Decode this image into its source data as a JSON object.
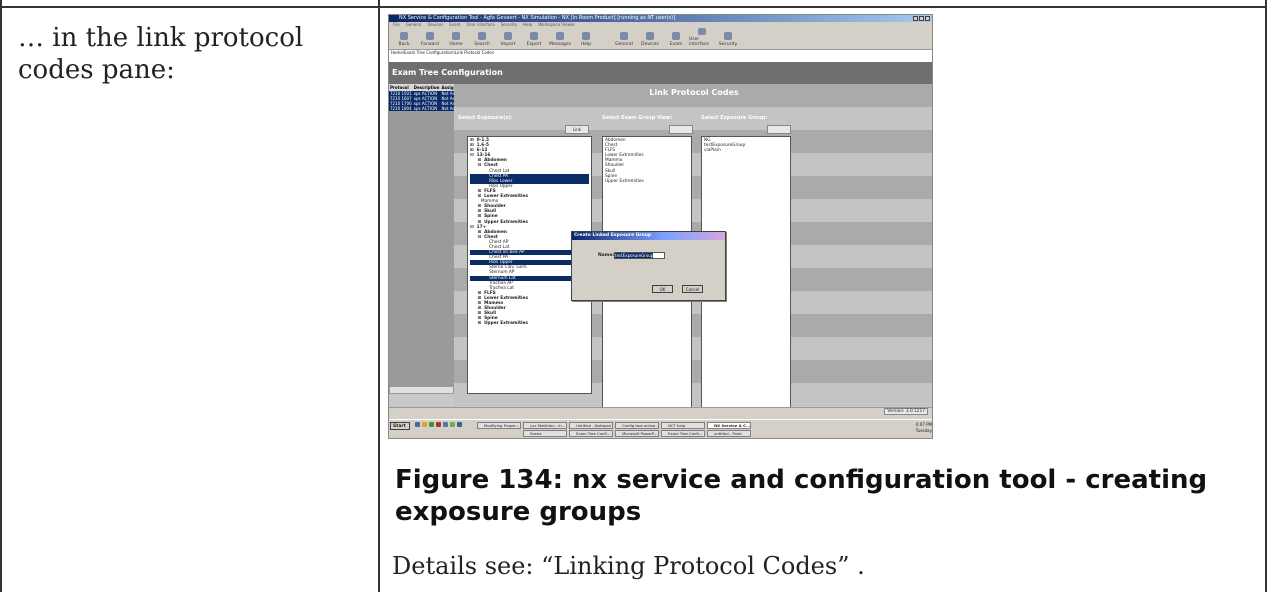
{
  "row_label": "… in the link protocol codes pane:",
  "figure_caption": "Figure 134: nx service and configuration tool - creating exposure groups",
  "details_text": "Details see: “Linking Protocol Codes” .",
  "screenshot": {
    "window_title": "NX Service & Configuration Tool - Agfa Gevaert - NX Simulation - NX [In Room Product] [running as NT user(s)]",
    "menu": [
      "File",
      "General",
      "Devices",
      "Exam",
      "User interface",
      "Security",
      "Help",
      "Workspace Viewer"
    ],
    "toolbar": [
      "Back",
      "Forward",
      "Home",
      "Search",
      "Import",
      "Export",
      "Messages",
      "Help",
      "General",
      "Devices",
      "Exam",
      "User interface",
      "Security"
    ],
    "breadcrumb": "Home\\Exam Tree Configuration\\Link Protocol Codes",
    "header": "Exam Tree Configuration",
    "protocol_table": {
      "columns": [
        "Protocol",
        "Description",
        "Assign"
      ],
      "rows": [
        [
          "7210 1501",
          "xps ACTION",
          "Not As"
        ],
        [
          "7210 1607",
          "xps ACTION",
          "Not As"
        ],
        [
          "7210 1706",
          "xps ACTION",
          "Not As"
        ],
        [
          "7210 1804",
          "xps ACTION",
          "Not As"
        ]
      ]
    },
    "pane_title": "Link Protocol Codes",
    "select_exposures_label": "Select Exposure(s):",
    "select_exam_group_label": "Select Exam Group View:",
    "select_exposure_group_label": "Select Exposure Group:",
    "link_button": "Link",
    "ellipsis_button": "...",
    "exposures": [
      {
        "t": "⊞  0-1.5",
        "s": "b"
      },
      {
        "t": "⊞  1.6-5",
        "s": "b"
      },
      {
        "t": "⊞  6-12",
        "s": "b"
      },
      {
        "t": "⊟  13-16",
        "s": "b"
      },
      {
        "t": "     ⊞  Abdomen",
        "s": "b"
      },
      {
        "t": "     ⊟  Chest",
        "s": "b"
      },
      {
        "t": "              Chest Lat",
        "s": ""
      },
      {
        "t": "              Chest PA",
        "s": "sel"
      },
      {
        "t": "              Ribs Lower",
        "s": "sel"
      },
      {
        "t": "              Ribs Upper",
        "s": ""
      },
      {
        "t": "     ⊞  FLFS",
        "s": "b"
      },
      {
        "t": "     ⊞  Lower Extremities",
        "s": "b"
      },
      {
        "t": "        Mammo",
        "s": ""
      },
      {
        "t": "     ⊞  Shoulder",
        "s": "b"
      },
      {
        "t": "     ⊞  Skull",
        "s": "b"
      },
      {
        "t": "     ⊞  Spine",
        "s": "b"
      },
      {
        "t": "     ⊞  Upper Extremities",
        "s": "b"
      },
      {
        "t": "⊟  17+",
        "s": "b"
      },
      {
        "t": "     ⊞  Abdomen",
        "s": "b"
      },
      {
        "t": "     ⊟  Chest",
        "s": "b"
      },
      {
        "t": "              Chest AP",
        "s": ""
      },
      {
        "t": "              Chest Lat",
        "s": ""
      },
      {
        "t": "              Chest on bed AP",
        "s": "sel"
      },
      {
        "t": "              Chest PA",
        "s": ""
      },
      {
        "t": "              Ribs Upper",
        "s": "sel"
      },
      {
        "t": "              Sterno Clav. Gem.",
        "s": ""
      },
      {
        "t": "              Sternum AP",
        "s": ""
      },
      {
        "t": "              Sternum Lat",
        "s": "sel"
      },
      {
        "t": "              Trachea AP",
        "s": ""
      },
      {
        "t": "              Trachea Lat",
        "s": ""
      },
      {
        "t": "     ⊞  FLFS",
        "s": "b"
      },
      {
        "t": "     ⊞  Lower Extremities",
        "s": "b"
      },
      {
        "t": "     ⊞  Mammo",
        "s": "b"
      },
      {
        "t": "     ⊞  Shoulder",
        "s": "b"
      },
      {
        "t": "     ⊞  Skull",
        "s": "b"
      },
      {
        "t": "     ⊞  Spine",
        "s": "b"
      },
      {
        "t": "     ⊞  Upper Extremities",
        "s": "b"
      }
    ],
    "exam_groups": [
      "Abdomen",
      "Chest",
      "FLFS",
      "Lower Extremities",
      "Mammo",
      "Shoulder",
      "Skull",
      "Spine",
      "Upper Extremities"
    ],
    "exposure_groups": [
      "NG",
      "testExposureGroup",
      "viaPlain"
    ],
    "dialog": {
      "title": "Create Linked Exposure Group",
      "name_label": "Name:",
      "name_value": "testExposureGroup",
      "ok": "OK",
      "cancel": "Cancel"
    },
    "version": "Version: 3.0.1217",
    "taskbar": {
      "start": "Start",
      "tasks": [
        "Modifying Proper...",
        "Luc Matthieu - In...",
        "Untitled - Notepad",
        "Config tool online...",
        "NCT help",
        "NX Service & C...",
        "Sasha",
        "Exam Tree Confi...",
        "Microsoft PowerP...",
        "Exam Tree Confi...",
        "untitled - Paint"
      ],
      "time": "6:07 PM",
      "day": "Tuesday"
    }
  }
}
